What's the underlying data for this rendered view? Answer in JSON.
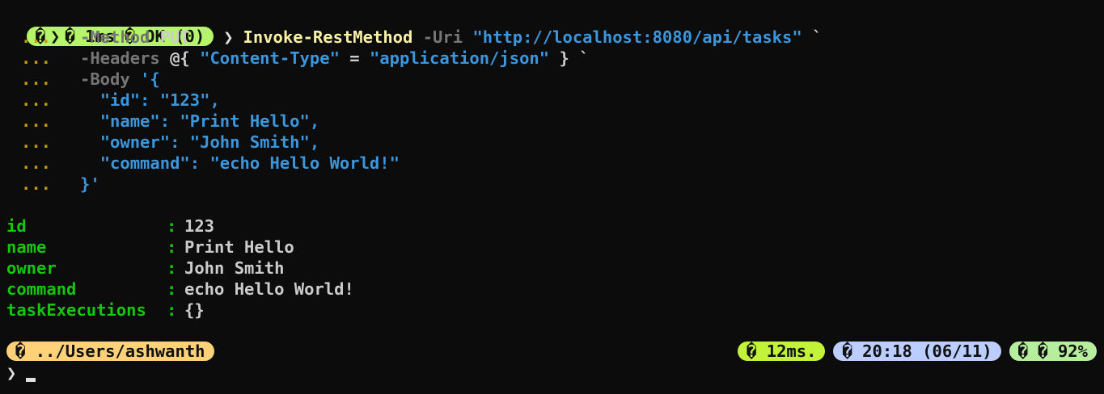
{
  "prompt": {
    "segment_glyph_1": "�",
    "segment_chevron": "❯",
    "segment_glyph_2": "�",
    "duration": "1ms",
    "status_glyph": "�",
    "status": "OK (0)",
    "caret": "❯"
  },
  "command": {
    "name": "Invoke-RestMethod",
    "uri_param": "-Uri",
    "uri_value": "\"http://localhost:8080/api/tasks\"",
    "line1_tail": "`",
    "continuation": "...",
    "method_param": "-Method",
    "method_value": "PUT",
    "method_tail": "`",
    "headers_param": "-Headers",
    "headers_open": "@{",
    "headers_key": "\"Content-Type\"",
    "headers_eq": "=",
    "headers_value": "\"application/json\"",
    "headers_close": "}",
    "headers_tail": "`",
    "body_param": "-Body",
    "body_open": "'{",
    "body_line_id": "\"id\": \"123\",",
    "body_line_name": "\"name\": \"Print Hello\",",
    "body_line_owner": "\"owner\": \"John Smith\",",
    "body_line_command": "\"command\": \"echo Hello World!\"",
    "body_close": "}'"
  },
  "output": {
    "separator": ":",
    "rows": [
      {
        "key": "id",
        "value": "123"
      },
      {
        "key": "name",
        "value": "Print Hello"
      },
      {
        "key": "owner",
        "value": "John Smith"
      },
      {
        "key": "command",
        "value": "echo Hello World!"
      },
      {
        "key": "taskExecutions",
        "value": "{}"
      }
    ]
  },
  "statusbar": {
    "path_glyph": "�",
    "path": "../Users/ashwanth",
    "exec_glyph": "�",
    "exec_time": "12ms.",
    "clock_glyph": "�",
    "clock": "20:18 (06/11)",
    "battery_glyph_1": "�",
    "battery_glyph_2": "�",
    "battery": "92%"
  },
  "final_prompt": {
    "caret": "❯"
  },
  "colors": {
    "background": "#0c0c0c",
    "pill_green": "#b6f56a",
    "pill_yellow": "#ffd27a",
    "pill_lime": "#c2f23a",
    "pill_blue": "#bccdff",
    "pill_mint": "#b7ee9d",
    "command": "#f9f1a5",
    "parameter": "#767676",
    "string": "#3a96dd",
    "continuation": "#c19c00",
    "output_key": "#16c60c"
  }
}
